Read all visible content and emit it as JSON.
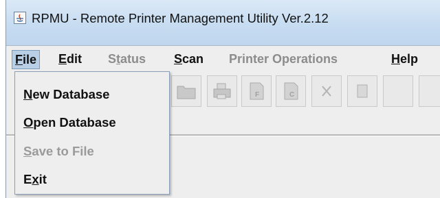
{
  "window": {
    "title": "RPMU - Remote Printer Management Utility Ver.2.12"
  },
  "menubar": {
    "file_pre": "",
    "file_mn": "F",
    "file_post": "ile",
    "edit_pre": "",
    "edit_mn": "E",
    "edit_post": "dit",
    "status_pre": "S",
    "status_mn": "t",
    "status_post": "atus",
    "scan_pre": "",
    "scan_mn": "S",
    "scan_post": "can",
    "printerops": "Printer Operations",
    "help_pre": "",
    "help_mn": "H",
    "help_post": "elp"
  },
  "file_menu": {
    "new_mn": "N",
    "new_post": "ew Database",
    "open_mn": "O",
    "open_post": "pen Database",
    "save_mn": "S",
    "save_post": "ave to File",
    "exit_pre": "E",
    "exit_mn": "x",
    "exit_post": "it"
  },
  "toolbar": {
    "buttons": [
      "folder-icon",
      "printer-icon",
      "file-f-icon",
      "file-c-icon",
      "tools-icon",
      "generic-icon"
    ]
  },
  "colors": {
    "titlebar": "#c7dcf1",
    "menu_active": "#b8cfe5",
    "disabled_text": "#8c8c8c"
  }
}
